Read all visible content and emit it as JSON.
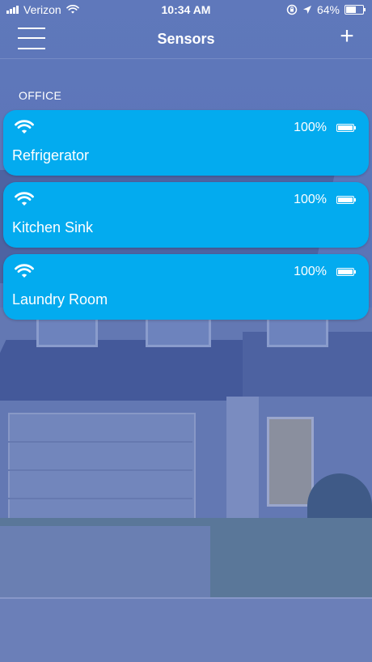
{
  "status_bar": {
    "carrier": "Verizon",
    "time": "10:34 AM",
    "battery_text": "64%",
    "battery_level": 0.64,
    "icons": [
      "signal-icon",
      "wifi-icon",
      "orientation-lock-icon",
      "location-arrow-icon",
      "battery-icon"
    ]
  },
  "nav": {
    "title": "Sensors",
    "menu_icon": "hamburger-menu-icon",
    "add_icon": "plus-icon",
    "add_glyph": "+"
  },
  "section": {
    "title": "OFFICE"
  },
  "sensors": [
    {
      "name": "Refrigerator",
      "battery": "100%",
      "battery_level": 1.0,
      "icon": "wifi-icon"
    },
    {
      "name": "Kitchen Sink",
      "battery": "100%",
      "battery_level": 1.0,
      "icon": "wifi-icon"
    },
    {
      "name": "Laundry Room",
      "battery": "100%",
      "battery_level": 1.0,
      "icon": "wifi-icon"
    }
  ],
  "colors": {
    "card": "#03abef",
    "overlay": "#5570b4"
  }
}
